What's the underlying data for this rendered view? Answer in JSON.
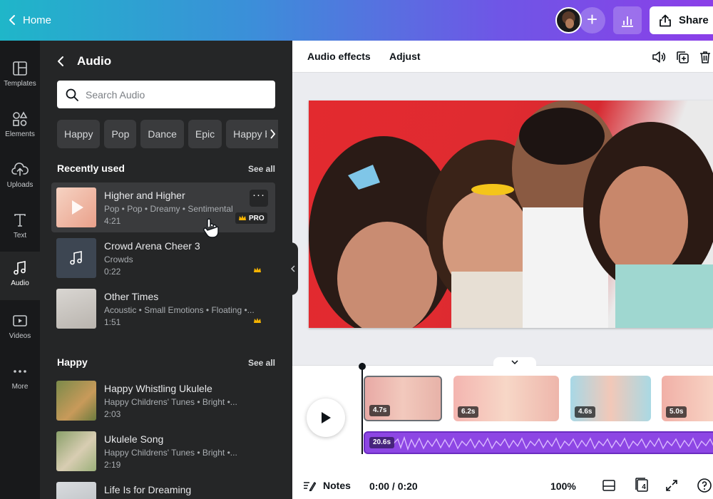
{
  "topbar": {
    "home_label": "Home",
    "share_label": "Share",
    "brand_gradient": [
      "#1fb6c9",
      "#6f56e6",
      "#8b3fe8"
    ]
  },
  "rail": {
    "items": [
      {
        "label": "Templates",
        "icon": "templates-icon"
      },
      {
        "label": "Elements",
        "icon": "elements-icon"
      },
      {
        "label": "Uploads",
        "icon": "uploads-icon"
      },
      {
        "label": "Text",
        "icon": "text-icon"
      },
      {
        "label": "Audio",
        "icon": "music-note-icon",
        "active": true
      },
      {
        "label": "Videos",
        "icon": "video-icon"
      },
      {
        "label": "More",
        "icon": "more-dots-icon"
      }
    ]
  },
  "panel": {
    "title": "Audio",
    "search_placeholder": "Search Audio",
    "chips": [
      "Happy",
      "Pop",
      "Dance",
      "Epic",
      "Happy b"
    ],
    "recent": {
      "title": "Recently used",
      "see_all": "See all",
      "tracks": [
        {
          "title": "Higher and Higher",
          "meta": "Pop • Pop • Dreamy • Sentimental",
          "duration": "4:21",
          "badge": "PRO"
        },
        {
          "title": "Crowd Arena Cheer 3",
          "meta": "Crowds",
          "duration": "0:22"
        },
        {
          "title": "Other Times",
          "meta": "Acoustic • Small Emotions • Floating •...",
          "duration": "1:51"
        }
      ]
    },
    "happy": {
      "title": "Happy",
      "see_all": "See all",
      "tracks": [
        {
          "title": "Happy Whistling Ukulele",
          "meta": "Happy Childrens' Tunes • Bright •...",
          "duration": "2:03"
        },
        {
          "title": "Ukulele Song",
          "meta": "Happy Childrens' Tunes • Bright •...",
          "duration": "2:19"
        },
        {
          "title": "Life Is for Dreaming",
          "meta": "",
          "duration": ""
        }
      ]
    }
  },
  "editor": {
    "tabs": [
      "Audio effects",
      "Adjust"
    ]
  },
  "timeline": {
    "clips": [
      "4.7s",
      "6.2s",
      "4.6s",
      "5.0s"
    ],
    "audio_duration": "20.6s",
    "audio_color": "#8d46e4",
    "notes_label": "Notes",
    "timecode": "0:00 / 0:20",
    "zoom": "100%",
    "page_count": "4"
  }
}
